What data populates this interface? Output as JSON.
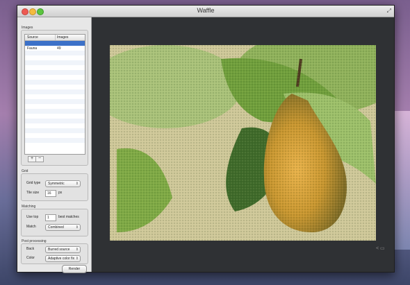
{
  "window": {
    "title": "Waffle"
  },
  "images": {
    "section_label": "Images",
    "columns": [
      "Source",
      "Images"
    ],
    "rows": [
      {
        "source": "",
        "images": "",
        "selected": true
      },
      {
        "source": "Fauna",
        "images": "49",
        "selected": false
      }
    ],
    "add_label": "+",
    "remove_label": "−"
  },
  "grid": {
    "section_label": "Grid",
    "grid_type_label": "Grid type",
    "grid_type_value": "Symmetric",
    "tile_size_label": "Tile size",
    "tile_size_value": "16",
    "tile_size_unit": "px"
  },
  "matching": {
    "section_label": "Matching",
    "use_top_label": "Use top",
    "use_top_value": "1",
    "best_matches_label": "best matches",
    "match_label": "Match",
    "match_value": "Combined"
  },
  "post_processing": {
    "section_label": "Post processing",
    "back_label": "Back",
    "back_value": "Burred source",
    "color_label": "Color",
    "color_value": "Adaptive color fix"
  },
  "actions": {
    "render_label": "Render"
  },
  "canvas": {
    "subject": "mosaic pear image"
  },
  "icons": {
    "share": "share-icon",
    "image": "image-icon",
    "fullscreen": "fullscreen-icon"
  }
}
